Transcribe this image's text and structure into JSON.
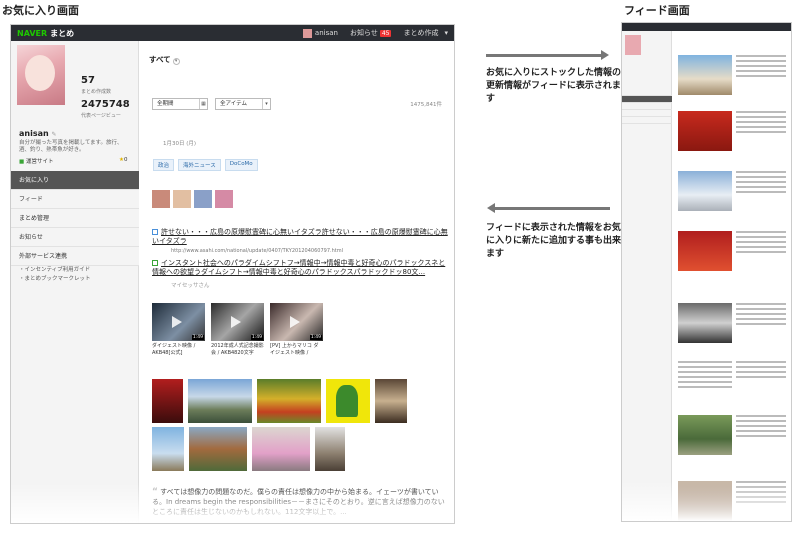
{
  "headings": {
    "favorites_screen": "お気に入り画面",
    "feed_screen": "フィード画面"
  },
  "topbar": {
    "brand": "NAVER",
    "logo_text": "まとめ",
    "user": "anisan",
    "notice_label": "お知らせ",
    "notice_count": "45",
    "create_label": "まとめ作成"
  },
  "profile": {
    "matome_count": "57",
    "matome_count_label": "まとめ作成数",
    "page_views": "2475748",
    "page_views_label": "代表ページビュー",
    "name": "anisan",
    "bio": "自分が撮った写真を掲載してます。旅行、酒、釣り、熱帯魚が好き。",
    "site_label": "運営サイト",
    "star_count": "0"
  },
  "nav": {
    "items": [
      "お気に入り",
      "フィード",
      "まとめ管理",
      "お知らせ",
      "外部サービス連携"
    ],
    "extra_links": [
      "・インセンティブ利用ガイド",
      "・まとめブックマークレット"
    ]
  },
  "main": {
    "filter_label": "すべて",
    "period_select": "全期間",
    "item_select": "全アイテム",
    "total_count": "1475,841件",
    "date": "1月30日 (月)",
    "tags": [
      "政治",
      "海外ニュース",
      "DoCoMo"
    ],
    "link1_text": "許せない・・・広島の原爆慰霊碑に心無いイタズラ許せない・・・広島の原爆慰霊碑に心無いイタズラ",
    "link1_url": "http://www.asahi.com/national/update/0407/TKY201204060797.html",
    "link2_text": "インスタント社会へのパラダイムシフトフ→情報中→情報中毒と好奇心のパラドックスネと情報への欲望うダイムシフト→情報中毒と好奇心のパラドックスパラドックドッ80文...",
    "link2_author": "マイセッサさん",
    "videos": [
      {
        "caption": "ダイジェスト映像 / AKB48[公式]",
        "duration": "1:49"
      },
      {
        "caption": "2012年成人式記念撮影会 / AKB4820文字",
        "duration": "1:49"
      },
      {
        "caption": "[PV] 上からマリコ ダイジェスト映像 /",
        "duration": "1:49"
      }
    ],
    "quote": "すべては想像力の問題なのだ。僕らの責任は想像力の中から始まる。イェーツが書いている。In dreams begin the responsibilities－－まさにそのとおり。逆に言えば想像力のないところに責任は生じないのかもしれない。112文字以上で。..."
  },
  "annotations": {
    "to_feed": "お気に入りにストックした情報の更新情報がフィードに表示されます",
    "to_favorites": "フィードに表示された情報をお気に入りに新たに追加する事も出来ます"
  },
  "colors": {
    "topbar_bg": "#2a2d33",
    "naver_green": "#1ec800",
    "active_nav_bg": "#555555",
    "notice_badge": "#e33333",
    "tag_text": "#2b6aa8",
    "arrow": "#777777"
  }
}
